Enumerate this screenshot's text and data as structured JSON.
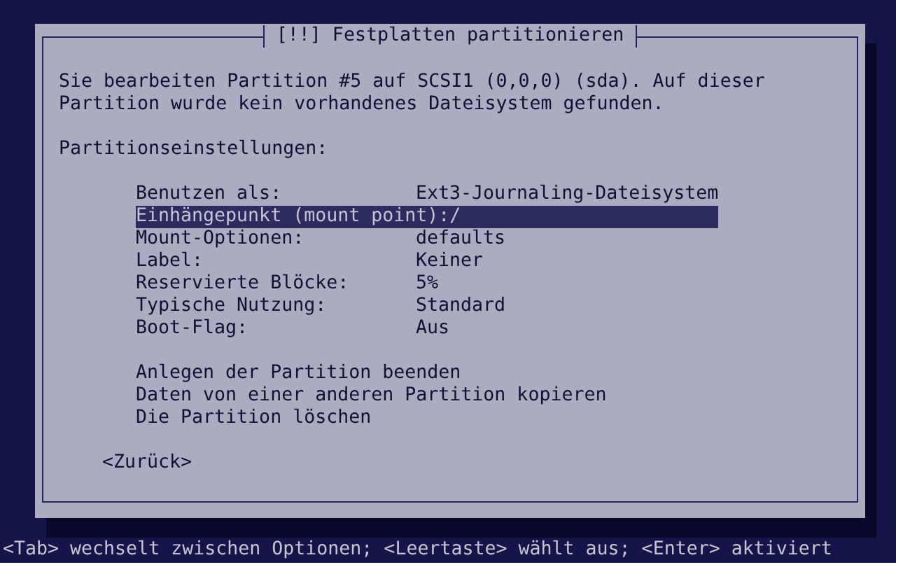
{
  "dialog": {
    "title": "[!!] Festplatten partitionieren",
    "message": "Sie bearbeiten Partition #5 auf SCSI1 (0,0,0) (sda). Auf dieser Partition wurde kein vorhandenes Dateisystem gefunden.",
    "settings_heading": "Partitionseinstellungen:",
    "settings": [
      {
        "label": "Benutzen als:",
        "value": "Ext3-Journaling-Dateisystem",
        "selected": false
      },
      {
        "label": "Einhängepunkt (mount point):",
        "value": "/",
        "selected": true
      },
      {
        "label": "Mount-Optionen:",
        "value": "defaults",
        "selected": false
      },
      {
        "label": "Label:",
        "value": "Keiner",
        "selected": false
      },
      {
        "label": "Reservierte Blöcke:",
        "value": "5%",
        "selected": false
      },
      {
        "label": "Typische Nutzung:",
        "value": "Standard",
        "selected": false
      },
      {
        "label": "Boot-Flag:",
        "value": "Aus",
        "selected": false
      }
    ],
    "actions": [
      {
        "label": "Anlegen der Partition beenden",
        "selected": false
      },
      {
        "label": "Daten von einer anderen Partition kopieren",
        "selected": false
      },
      {
        "label": "Die Partition löschen",
        "selected": false
      }
    ],
    "back_button": "<Zurück>"
  },
  "status_bar": "<Tab> wechselt zwischen Optionen; <Leertaste> wählt aus; <Enter> aktiviert"
}
